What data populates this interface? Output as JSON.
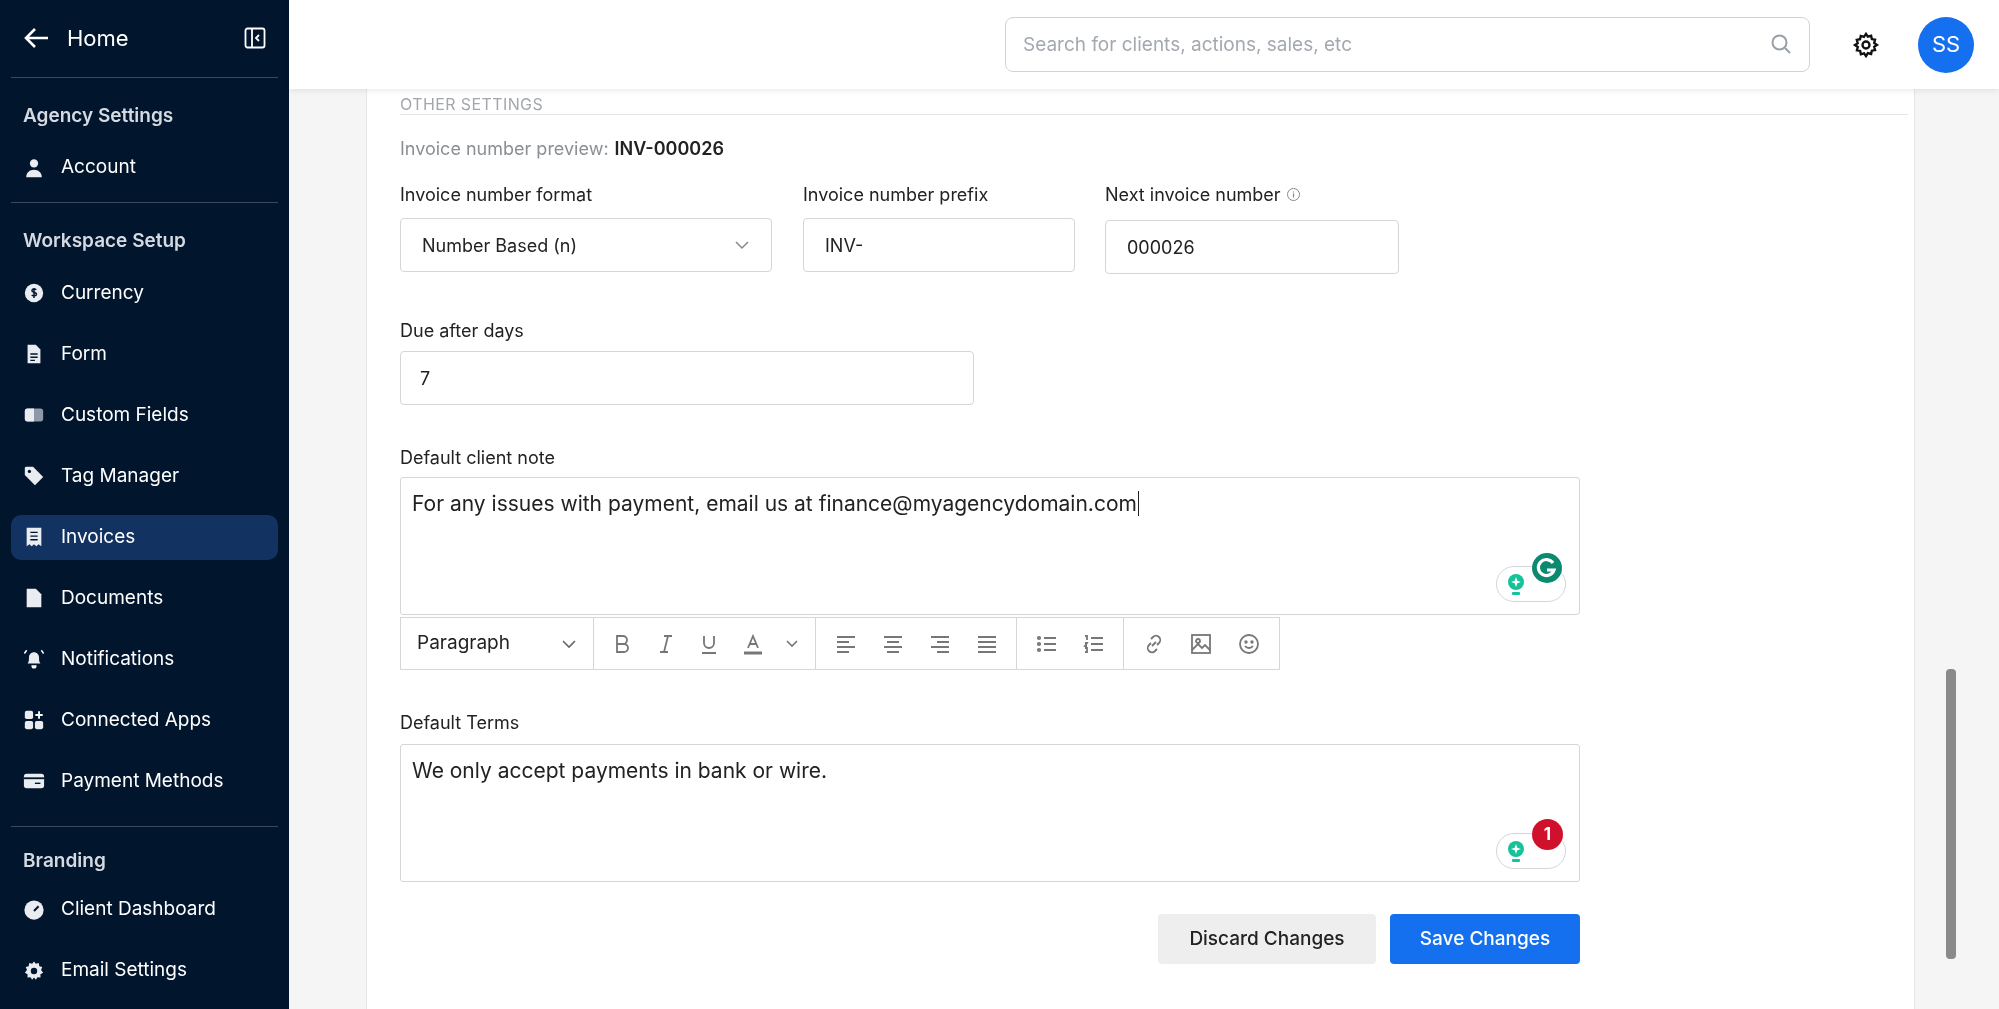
{
  "sidebar": {
    "back_label": "Home",
    "sections": [
      {
        "title": "Agency Settings",
        "items": [
          {
            "label": "Account",
            "selected": false
          }
        ]
      },
      {
        "title": "Workspace Setup",
        "items": [
          {
            "label": "Currency",
            "selected": false
          },
          {
            "label": "Form",
            "selected": false
          },
          {
            "label": "Custom Fields",
            "selected": false
          },
          {
            "label": "Tag Manager",
            "selected": false
          },
          {
            "label": "Invoices",
            "selected": true
          },
          {
            "label": "Documents",
            "selected": false
          },
          {
            "label": "Notifications",
            "selected": false
          },
          {
            "label": "Connected Apps",
            "selected": false
          },
          {
            "label": "Payment Methods",
            "selected": false
          }
        ]
      },
      {
        "title": "Branding",
        "items": [
          {
            "label": "Client Dashboard",
            "selected": false
          },
          {
            "label": "Email Settings",
            "selected": false
          }
        ]
      }
    ]
  },
  "header": {
    "search": {
      "placeholder": "Search for clients, actions, sales, etc"
    },
    "avatar": "SS"
  },
  "form": {
    "section_title": "OTHER SETTINGS",
    "preview_label": "Invoice number preview:",
    "preview_value": "INV-000026",
    "fields": [
      {
        "label": "Invoice number format",
        "value": "Number Based (n)",
        "kind": "select"
      },
      {
        "label": "Invoice number prefix",
        "value": "INV-",
        "kind": "text"
      },
      {
        "label": "Next invoice number",
        "value": "000026",
        "kind": "info"
      }
    ],
    "due": {
      "label": "Due after days",
      "value": "7"
    },
    "note": {
      "label": "Default client note",
      "text": "For any issues with payment, email us at finance@myagencydomain.com",
      "assistant": {
        "kind": "logo"
      }
    },
    "toolbar": {
      "block_format": "Paragraph"
    },
    "terms": {
      "label": "Default Terms",
      "text": "We only accept payments in bank or wire.",
      "assistant": {
        "kind": "count",
        "count": "1"
      }
    },
    "buttons": [
      {
        "label": "Discard Changes",
        "kind": "secondary"
      },
      {
        "label": "Save Changes",
        "kind": "primary"
      }
    ]
  }
}
